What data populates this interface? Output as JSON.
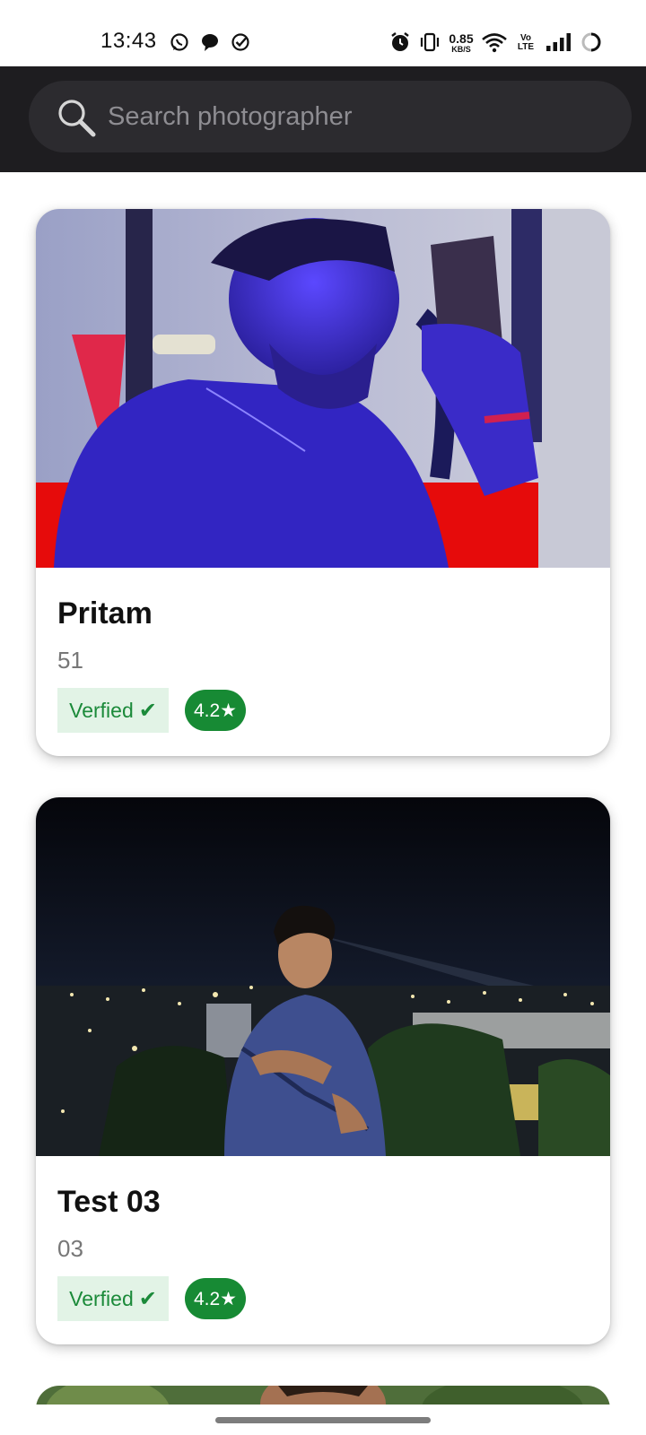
{
  "status_bar": {
    "time": "13:43",
    "net_speed_value": "0.85",
    "net_speed_unit": "KB/S",
    "volte_top": "Vo",
    "volte_bottom": "LTE",
    "icons": [
      "whatsapp-icon",
      "chat-bubble-icon",
      "check-circle-icon",
      "alarm-icon",
      "vibrate-icon",
      "wifi-icon",
      "volte-icon",
      "signal-icon",
      "battery-icon"
    ]
  },
  "search": {
    "placeholder": "Search photographer",
    "value": ""
  },
  "photographers": [
    {
      "name": "Pritam",
      "subtitle": "51",
      "verified_label": "Verfied",
      "rating": "4.2★"
    },
    {
      "name": "Test 03",
      "subtitle": "03",
      "verified_label": "Verfied",
      "rating": "4.2★"
    }
  ],
  "colors": {
    "header_bg": "#1e1d20",
    "search_bg": "#2c2b2f",
    "verified_bg": "#e2f3e6",
    "verified_text": "#1b8a3a",
    "rating_bg": "#178a34"
  }
}
